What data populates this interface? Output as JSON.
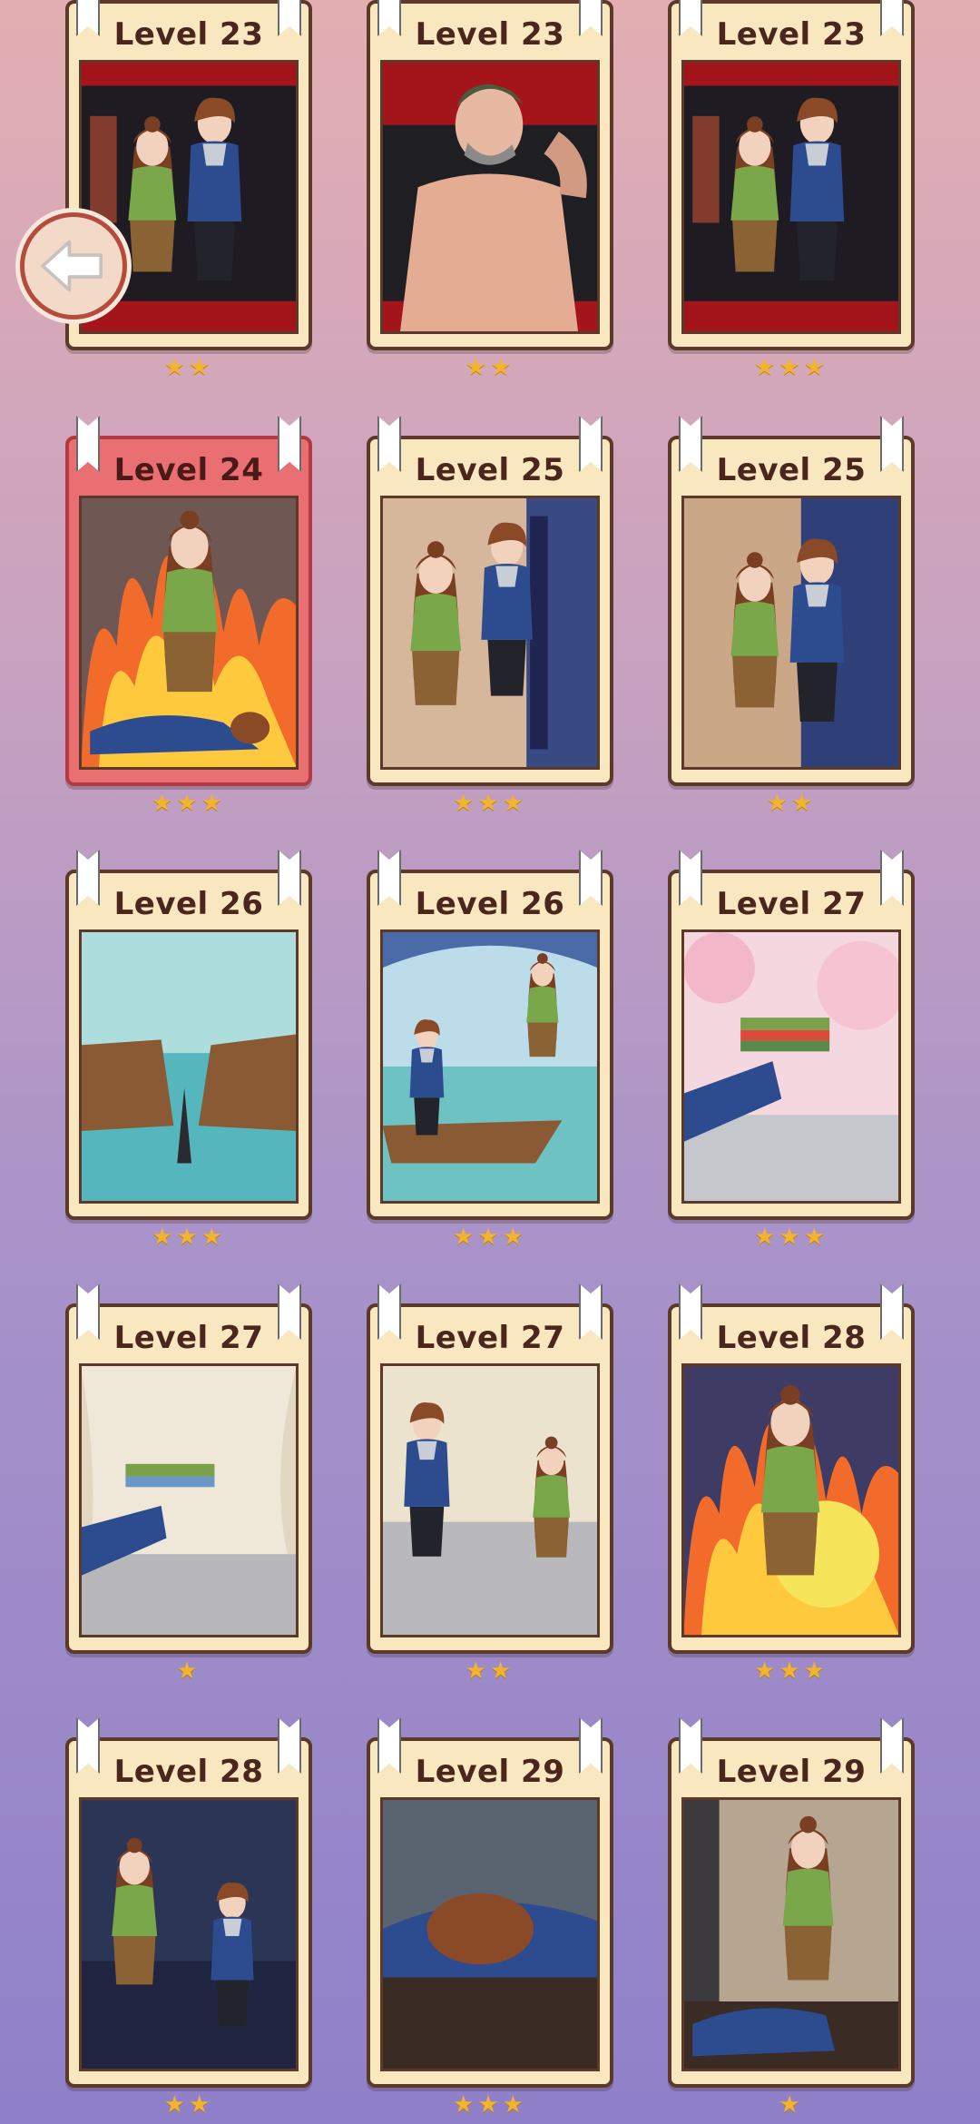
{
  "levels": [
    {
      "label": "Level 23",
      "stars": 2,
      "scene": "couple-dark"
    },
    {
      "label": "Level 23",
      "stars": 2,
      "scene": "man-shirtless"
    },
    {
      "label": "Level 23",
      "stars": 3,
      "scene": "couple-dark"
    },
    {
      "label": "Level 24",
      "stars": 3,
      "scene": "fire-sitting",
      "selected": true
    },
    {
      "label": "Level 25",
      "stars": 3,
      "scene": "couple-lean"
    },
    {
      "label": "Level 25",
      "stars": 2,
      "scene": "couple-side"
    },
    {
      "label": "Level 26",
      "stars": 3,
      "scene": "boat-broken"
    },
    {
      "label": "Level 26",
      "stars": 3,
      "scene": "boat-standing"
    },
    {
      "label": "Level 27",
      "stars": 3,
      "scene": "hands-blossom"
    },
    {
      "label": "Level 27",
      "stars": 1,
      "scene": "hands-curtain"
    },
    {
      "label": "Level 27",
      "stars": 2,
      "scene": "couple-curtain"
    },
    {
      "label": "Level 28",
      "stars": 3,
      "scene": "fire-angry"
    },
    {
      "label": "Level 28",
      "stars": 2,
      "scene": "bar-fight"
    },
    {
      "label": "Level 29",
      "stars": 3,
      "scene": "sleeping"
    },
    {
      "label": "Level 29",
      "stars": 1,
      "scene": "girl-kneel"
    }
  ],
  "back_button": {
    "icon": "arrow-left-icon"
  },
  "colors": {
    "card_bg": "#f8e7bf",
    "card_border": "#5b3a2a",
    "selected_bg": "#e96f72",
    "star": "#f2b32e"
  }
}
